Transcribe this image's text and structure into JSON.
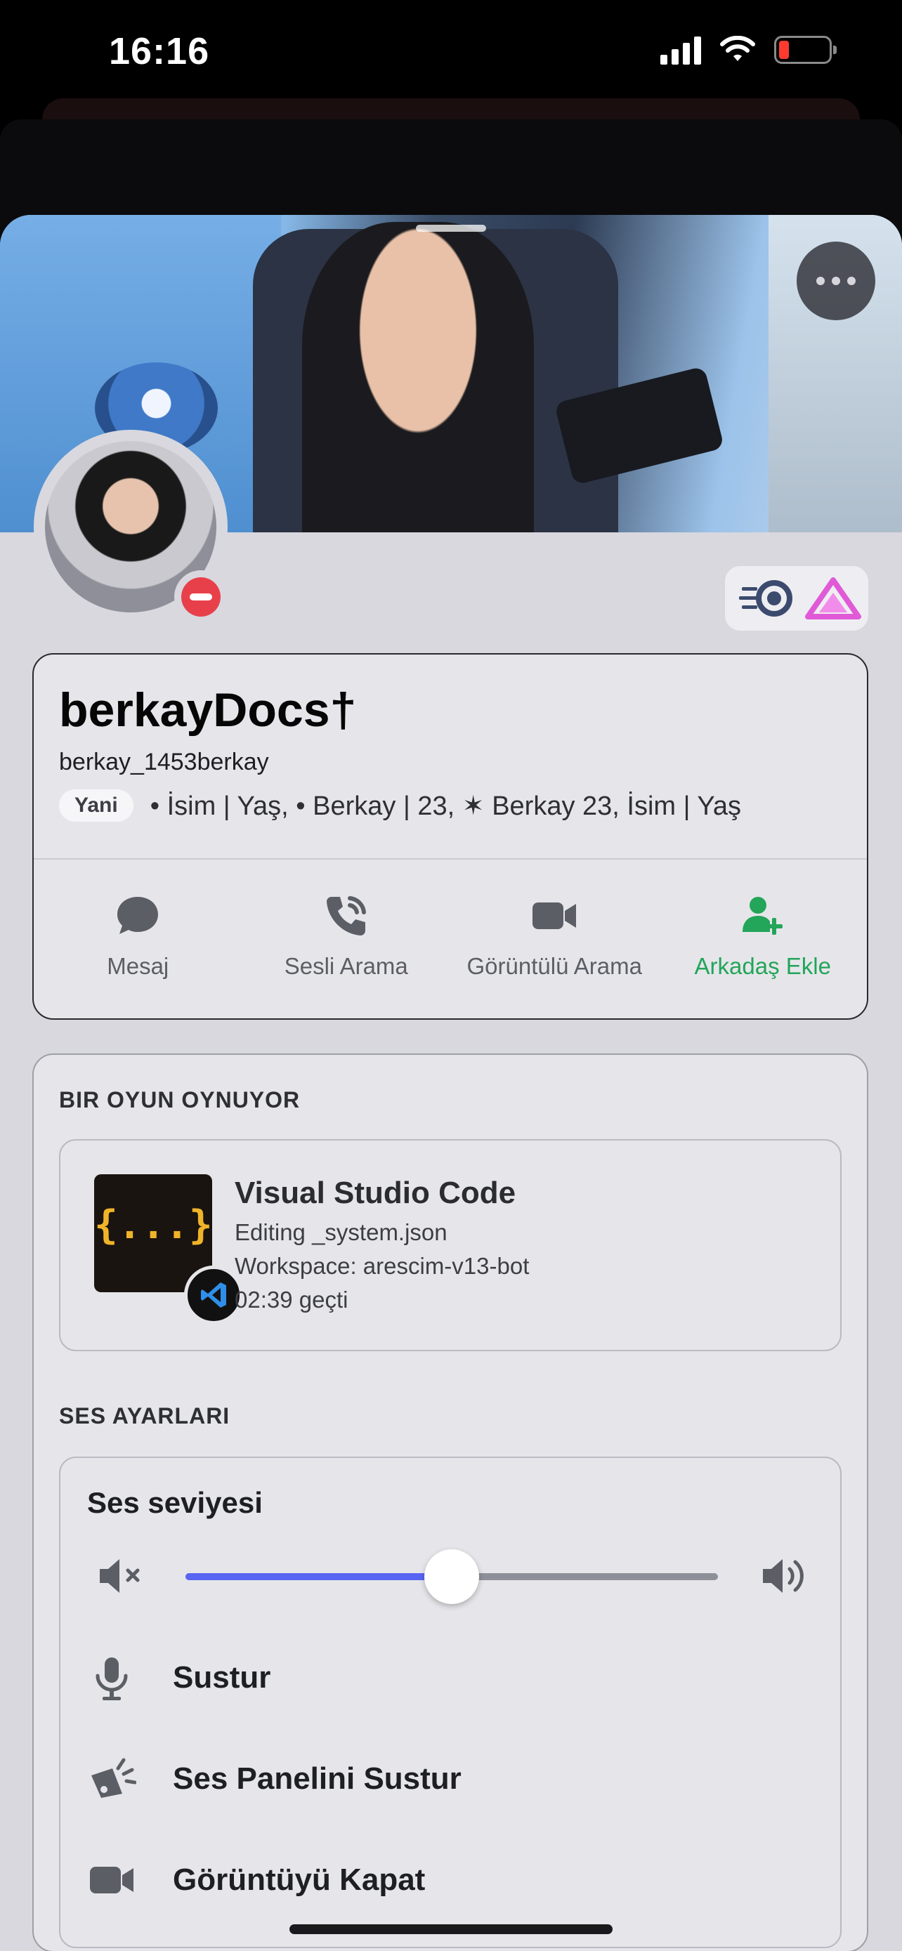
{
  "status_bar": {
    "time": "16:16"
  },
  "profile": {
    "display_name": "berkayDocs†",
    "username": "berkay_1453berkay",
    "pronoun_tag": "Yani",
    "bio": "• İsim | Yaş, • Berkay | 23, ✶ Berkay 23, İsim | Yaş"
  },
  "actions": [
    {
      "label": "Mesaj",
      "icon": "chat-bubble-icon"
    },
    {
      "label": "Sesli Arama",
      "icon": "phone-call-icon"
    },
    {
      "label": "Görüntülü Arama",
      "icon": "video-camera-icon"
    },
    {
      "label": "Arkadaş Ekle",
      "icon": "add-friend-icon"
    }
  ],
  "activity": {
    "section_title": "BIR OYUN OYNUYOR",
    "game_title": "Visual Studio Code",
    "details": "Editing _system.json",
    "state": "Workspace: arescim-v13-bot",
    "elapsed": "02:39 geçti",
    "icon_text": "{...}"
  },
  "voice": {
    "section_title": "SES AYARLARI",
    "volume_label": "Ses seviyesi",
    "volume_level": 0.5,
    "options": [
      {
        "label": "Sustur",
        "icon": "microphone-icon"
      },
      {
        "label": "Ses Panelini Sustur",
        "icon": "soundboard-icon"
      },
      {
        "label": "Görüntüyü Kapat",
        "icon": "video-camera-icon"
      }
    ]
  },
  "colors": {
    "accent": "#5865f2",
    "success": "#23a55a",
    "dnd": "#e8404a"
  }
}
